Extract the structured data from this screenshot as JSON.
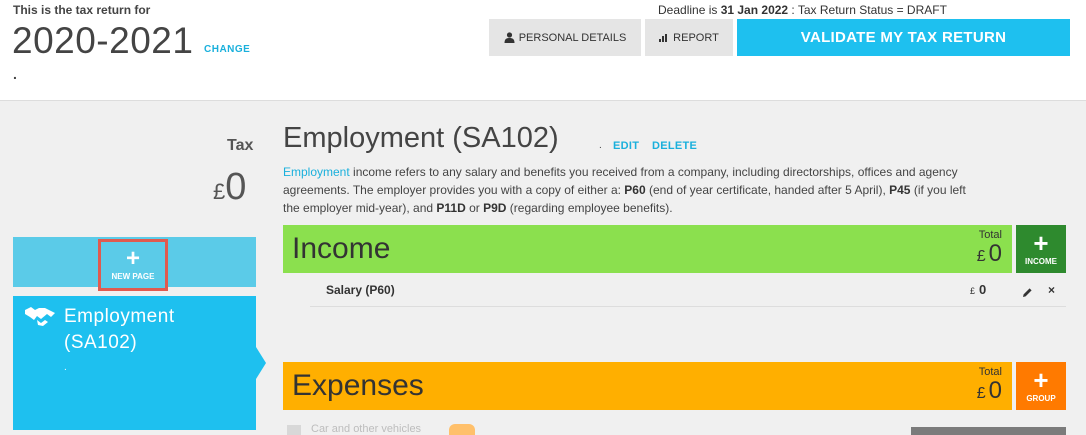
{
  "header": {
    "intro": "This is the tax return for",
    "year": "2020-2021",
    "change_link": "CHANGE",
    "dot": ".",
    "deadline_prefix": "Deadline is ",
    "deadline_date": "31 Jan 2022",
    "deadline_status": " : Tax Return Status = DRAFT",
    "personal_details_label": "PERSONAL DETAILS",
    "report_label": "REPORT",
    "validate_label": "VALIDATE MY TAX RETURN",
    "accent_color": "#1ec0ef"
  },
  "left": {
    "tax_label": "Tax",
    "tax_currency": "£",
    "tax_value": "0",
    "new_page_label": "NEW PAGE",
    "new_page_icon": "plus-icon",
    "page_icon": "handshake-icon",
    "page_title": "Employment (SA102)",
    "page_dot": "."
  },
  "main": {
    "title": "Employment (SA102)",
    "title_dot": ".",
    "edit_label": "EDIT",
    "delete_label": "DELETE",
    "desc": {
      "link": "Employment",
      "t1": " income refers to any salary and benefits you received from a company, including directorships, offices and agency agreements. The employer provides you with a copy of either a: ",
      "b1": "P60",
      "t2": " (end of year certificate, handed after 5 April), ",
      "b2": "P45",
      "t3": " (if you left the employer mid-year), and ",
      "b3": "P11D",
      "t4": " or ",
      "b4": "P9D",
      "t5": " (regarding employee benefits)."
    },
    "income": {
      "title": "Income",
      "total_label": "Total",
      "total_currency": "£",
      "total_value": "0",
      "add_label": "INCOME",
      "color": "#8be04e",
      "rows": [
        {
          "label": "Salary (P60)",
          "currency": "£",
          "value": "0"
        }
      ]
    },
    "expenses": {
      "title": "Expenses",
      "total_label": "Total",
      "total_currency": "£",
      "total_value": "0",
      "add_label": "GROUP",
      "color": "#ffaf00",
      "partial_row": "Car and other vehicles"
    }
  }
}
